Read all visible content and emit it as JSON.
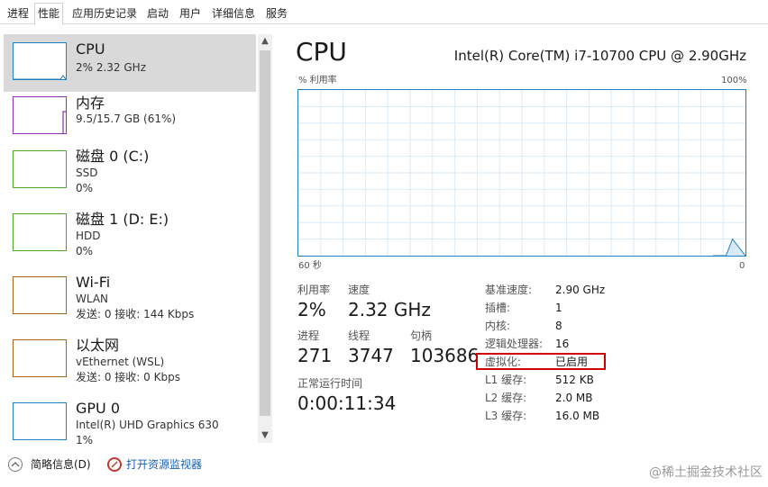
{
  "tabs": [
    "进程",
    "性能",
    "应用历史记录",
    "启动",
    "用户",
    "详细信息",
    "服务"
  ],
  "sidebar": {
    "items": [
      {
        "title": "CPU",
        "sub1": "2% 2.32 GHz",
        "sub2": "",
        "sub3": "",
        "color": "#1f7ec4"
      },
      {
        "title": "内存",
        "sub1": "9.5/15.7 GB (61%)",
        "sub2": "",
        "sub3": "",
        "color": "#8b2fae"
      },
      {
        "title": "磁盘 0 (C:)",
        "sub1": "SSD",
        "sub2": "0%",
        "sub3": "",
        "color": "#4ea72a"
      },
      {
        "title": "磁盘 1 (D: E:)",
        "sub1": "HDD",
        "sub2": "0%",
        "sub3": "",
        "color": "#4ea72a"
      },
      {
        "title": "Wi-Fi",
        "sub1": "WLAN",
        "sub2": "发送: 0 接收: 144 Kbps",
        "sub3": "",
        "color": "#a8641b"
      },
      {
        "title": "以太网",
        "sub1": "vEthernet (WSL)",
        "sub2": "发送: 0 接收: 0 Kbps",
        "sub3": "",
        "color": "#a8641b"
      },
      {
        "title": "GPU 0",
        "sub1": "Intel(R) UHD Graphics 630",
        "sub2": "1%",
        "sub3": "",
        "color": "#1f7ec4"
      }
    ]
  },
  "main": {
    "title": "CPU",
    "cpu_name": "Intel(R) Core(TM) i7-10700 CPU @ 2.90GHz",
    "graph": {
      "ylabel": "% 利用率",
      "ymax_label": "100%",
      "xlabel_left": "60 秒",
      "xlabel_right": "0",
      "line_color": "#1f7ec4",
      "recent_usage_pct": [
        0,
        0,
        0,
        10,
        5,
        0
      ]
    },
    "stats": {
      "utilization_label": "利用率",
      "utilization_value": "2%",
      "speed_label": "速度",
      "speed_value": "2.32 GHz",
      "processes_label": "进程",
      "processes_value": "271",
      "threads_label": "线程",
      "threads_value": "3747",
      "handles_label": "句柄",
      "handles_value": "103686",
      "uptime_label": "正常运行时间",
      "uptime_value": "0:00:11:34"
    },
    "details": [
      {
        "label": "基准速度:",
        "value": "2.90 GHz"
      },
      {
        "label": "插槽:",
        "value": "1"
      },
      {
        "label": "内核:",
        "value": "8"
      },
      {
        "label": "逻辑处理器:",
        "value": "16"
      },
      {
        "label": "虚拟化:",
        "value": "已启用"
      },
      {
        "label": "L1 缓存:",
        "value": "512 KB"
      },
      {
        "label": "L2 缓存:",
        "value": "2.0 MB"
      },
      {
        "label": "L3 缓存:",
        "value": "16.0 MB"
      }
    ]
  },
  "footer": {
    "summary_label": "简略信息(D)",
    "monitor_label": "打开资源监视器",
    "watermark": "@稀土掘金技术社区"
  }
}
